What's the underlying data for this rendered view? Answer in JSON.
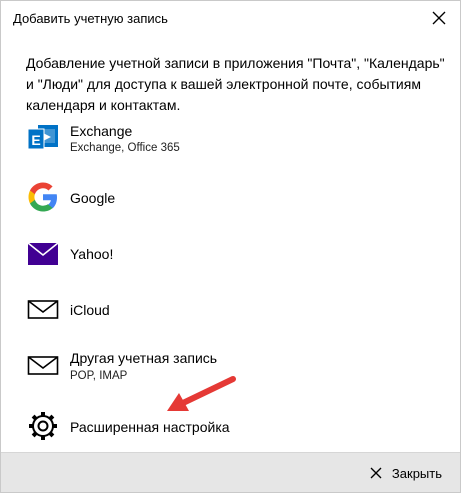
{
  "window": {
    "title": "Добавить учетную запись"
  },
  "description": "Добавление учетной записи в приложения \"Почта\", \"Календарь\" и \"Люди\" для доступа к вашей электронной почте, событиям календаря и контактам.",
  "accounts": [
    {
      "name": "Exchange",
      "sub": "Exchange, Office 365",
      "icon": "exchange-icon"
    },
    {
      "name": "Google",
      "sub": "",
      "icon": "google-icon"
    },
    {
      "name": "Yahoo!",
      "sub": "",
      "icon": "yahoo-icon"
    },
    {
      "name": "iCloud",
      "sub": "",
      "icon": "mail-envelope-icon"
    },
    {
      "name": "Другая учетная запись",
      "sub": "POP, IMAP",
      "icon": "mail-envelope-icon"
    },
    {
      "name": "Расширенная настройка",
      "sub": "",
      "icon": "gear-icon"
    }
  ],
  "footer": {
    "close_label": "Закрыть"
  },
  "colors": {
    "exchange_blue": "#0072c6",
    "yahoo_purple": "#410093",
    "google_blue": "#4285f4",
    "google_red": "#ea4335",
    "google_yellow": "#fbbc05",
    "google_green": "#34a853",
    "arrow_red": "#e53935",
    "footer_bg": "#e6e6e6"
  }
}
